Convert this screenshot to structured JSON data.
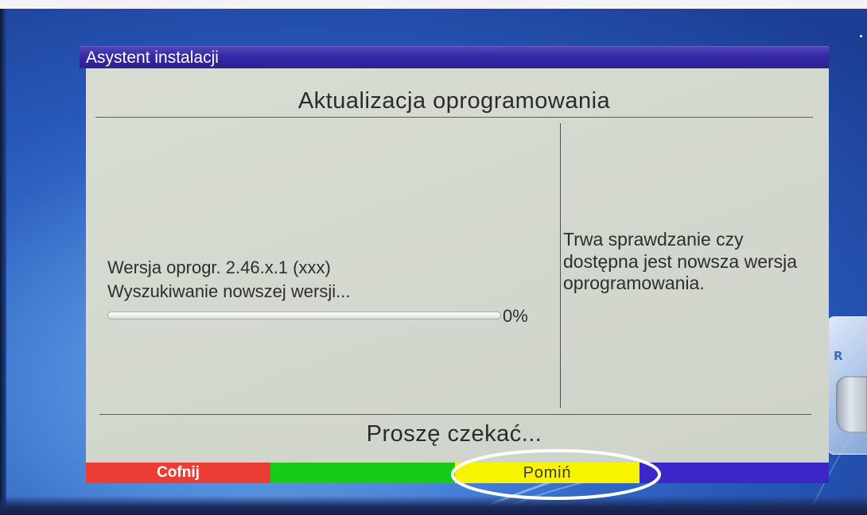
{
  "window": {
    "title": "Asystent instalacji"
  },
  "heading": "Aktualizacja oprogramowania",
  "left_panel": {
    "version": "Wersja oprogr. 2.46.x.1 (xxx)",
    "status": "Wyszukiwanie nowszej wersji...",
    "progress_percent": 0,
    "progress_label": "0%"
  },
  "right_panel": {
    "lines": [
      "Trwa sprawdzanie czy",
      "dostępna jest nowsza wersja",
      "oprogramowania."
    ]
  },
  "footer_message": "Proszę czekać...",
  "color_buttons": [
    {
      "label": "Cofnij",
      "color": "#ec3c36",
      "text_color": "#ffffff"
    },
    {
      "label": "",
      "color": "#17cb17",
      "text_color": "#ffffff"
    },
    {
      "label": "Pomiń",
      "color": "#f8f400",
      "text_color": "#3a3a2e"
    },
    {
      "label": "",
      "color": "#3b27c9",
      "text_color": "#ffffff"
    }
  ],
  "colors": {
    "titlebar": "#3628a8",
    "panel": "#d5dad0",
    "annotation": "#ffffff"
  },
  "desktop_icon": {
    "icon": "recycle-bin-icon",
    "letter": "R"
  }
}
